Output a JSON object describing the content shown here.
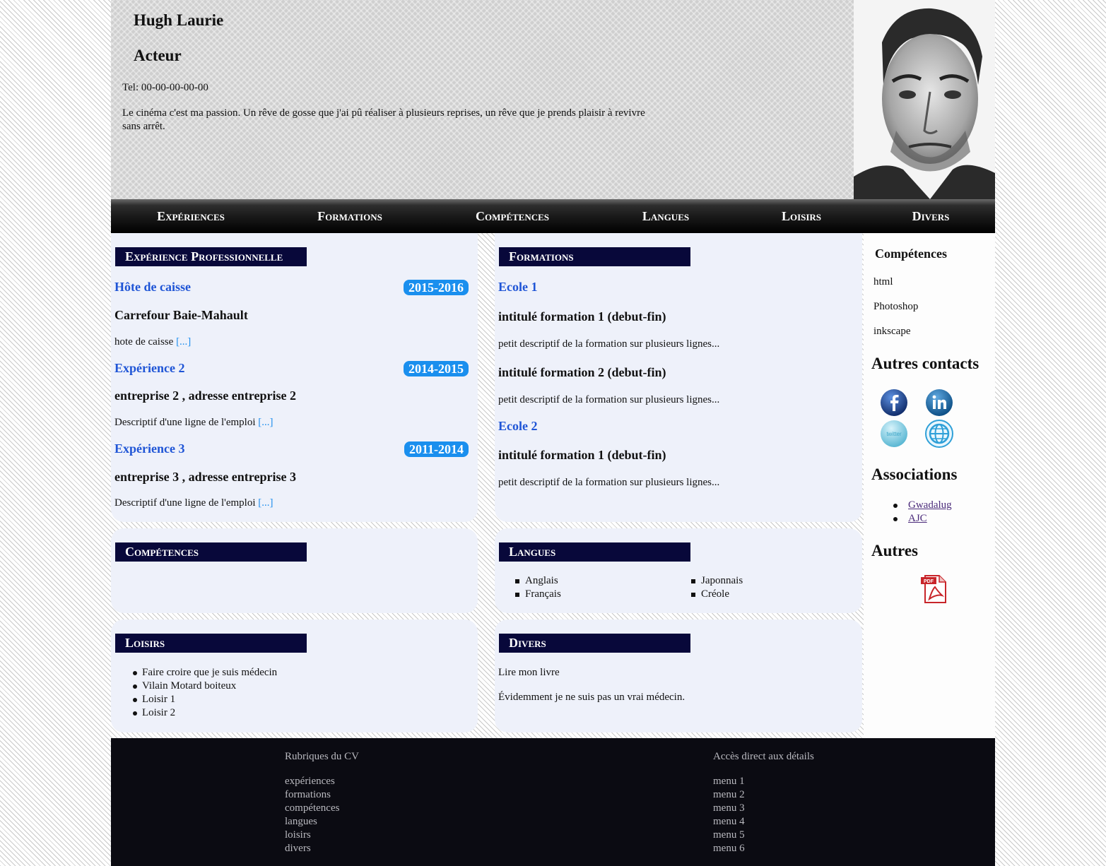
{
  "header": {
    "name": "Hugh Laurie",
    "job": "Acteur",
    "tel": "Tel: 00-00-00-00-00",
    "description": "Le cinéma c'est ma passion. Un rêve de gosse que j'ai pû réaliser à plusieurs reprises, un rêve que je prends plaisir à revivre sans arrêt."
  },
  "nav": [
    "Expériences",
    "Formations",
    "Compétences",
    "Langues",
    "Loisirs",
    "Divers"
  ],
  "experience": {
    "title": "Expérience Professionnelle",
    "items": [
      {
        "title": "Hôte de caisse",
        "dates": "2015-2016",
        "company": "Carrefour Baie-Mahault",
        "desc": "hote de caisse",
        "more": "[...]"
      },
      {
        "title": "Expérience 2",
        "dates": "2014-2015",
        "company": "entreprise 2 , adresse entreprise 2",
        "desc": "Descriptif d'une ligne de l'emploi",
        "more": "[...]"
      },
      {
        "title": "Expérience 3",
        "dates": "2011-2014",
        "company": "entreprise 3 , adresse entreprise 3",
        "desc": "Descriptif d'une ligne de l'emploi",
        "more": "[...]"
      }
    ]
  },
  "formations": {
    "title": "Formations",
    "school1": "Ecole 1",
    "school2": "Ecole 2",
    "items": [
      {
        "title": "intitulé formation 1 (debut-fin)",
        "desc": "petit descriptif de la formation sur plusieurs lignes..."
      },
      {
        "title": "intitulé formation 2 (debut-fin)",
        "desc": "petit descriptif de la formation sur plusieurs lignes..."
      },
      {
        "title": "intitulé formation 1 (debut-fin)",
        "desc": "petit descriptif de la formation sur plusieurs lignes..."
      }
    ]
  },
  "competences": {
    "title": "Compétences"
  },
  "langues": {
    "title": "Langues",
    "items": [
      "Anglais",
      "Français",
      "Japonnais",
      "Créole"
    ]
  },
  "loisirs": {
    "title": "Loisirs",
    "items": [
      "Faire croire que je suis médecin",
      "Vilain Motard boiteux",
      "Loisir 1",
      "Loisir 2"
    ]
  },
  "divers": {
    "title": "Divers",
    "lines": [
      "Lire mon livre",
      "Évidemment je ne suis pas un vrai médecin."
    ]
  },
  "sidebar": {
    "competences_title": "Compétences",
    "competences": [
      "html",
      "Photoshop",
      "inkscape"
    ],
    "contacts_title": "Autres contacts",
    "contact_icons": [
      "facebook-icon",
      "linkedin-icon",
      "twitter-icon",
      "website-icon"
    ],
    "twitter_label": "twitter",
    "associations_title": "Associations",
    "associations": [
      "Gwadalug",
      "AJC"
    ],
    "autres_title": "Autres",
    "pdf_label": "PDF"
  },
  "footer": {
    "col1_title": "Rubriques du CV",
    "col1_links": [
      "expériences",
      "formations",
      "compétences",
      "langues",
      "loisirs",
      "divers"
    ],
    "col2_title": "Accès direct aux détails",
    "col2_links": [
      "menu 1",
      "menu 2",
      "menu 3",
      "menu 4",
      "menu 5",
      "menu 6"
    ]
  },
  "colors": {
    "accent_blue": "#1f55d6",
    "badge_blue": "#1a8fee",
    "title_bar": "#08083a",
    "footer_bg": "#0b0b12"
  }
}
